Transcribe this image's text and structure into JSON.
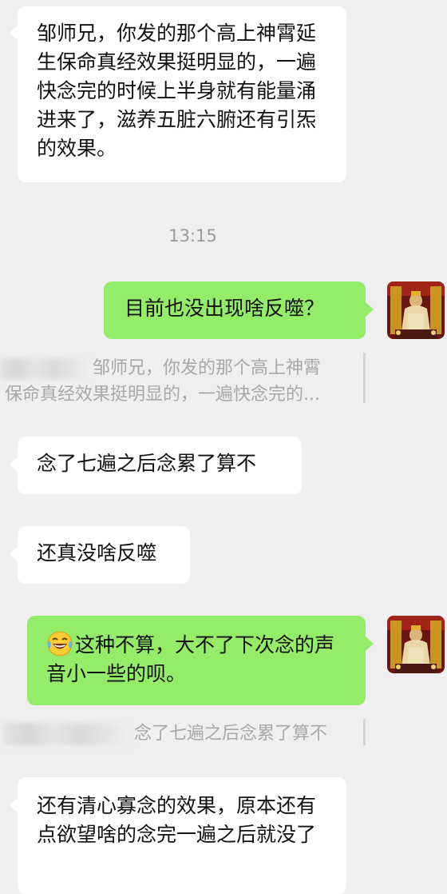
{
  "messages": [
    {
      "side": "left",
      "text": "邹师兄，你发的那个高上神霄延生保命真经效果挺明显的，一遍快念完的时候上半身就有能量涌进来了，滋养五脏六腑还有引炁的效果。"
    },
    {
      "type": "time",
      "text": "13:15"
    },
    {
      "side": "right",
      "text": "目前也没出现啥反噬？"
    },
    {
      "type": "quote",
      "line1": "邹师兄，你发的那个高上神霄",
      "line2": "保命真经效果挺明显的，一遍快念完的..."
    },
    {
      "side": "left",
      "text": "念了七遍之后念累了算不"
    },
    {
      "side": "left",
      "text": "还真没啥反噬"
    },
    {
      "side": "right",
      "emoji": "laughing-with-tears",
      "text": "这种不算，大不了下次念的声音小一些的呗。"
    },
    {
      "type": "quote",
      "line1": "念了七遍之后念累了算不"
    },
    {
      "side": "left",
      "text": "还有清心寡念的效果，原本还有点欲望啥的念完一遍之后就没了"
    }
  ],
  "colors": {
    "background": "#efeff1",
    "left_bubble": "#ffffff",
    "right_bubble": "#95ec69",
    "meta_text": "#9b9b9b"
  }
}
